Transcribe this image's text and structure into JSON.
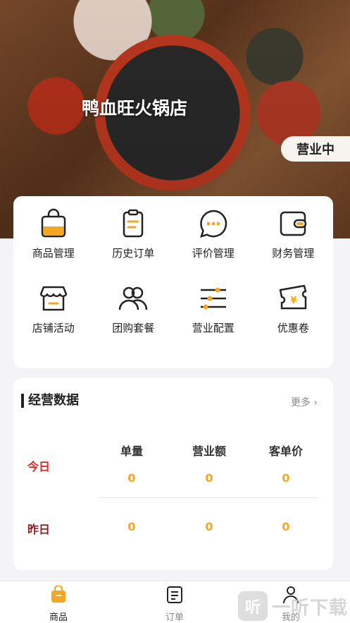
{
  "shop": {
    "name": "鸭血旺火锅店",
    "status": "营业中"
  },
  "menu": {
    "items": [
      {
        "label": "商品管理",
        "icon": "shopping-bag-icon"
      },
      {
        "label": "历史订单",
        "icon": "clipboard-icon"
      },
      {
        "label": "评价管理",
        "icon": "chat-bubble-icon"
      },
      {
        "label": "财务管理",
        "icon": "wallet-icon"
      },
      {
        "label": "店铺活动",
        "icon": "storefront-icon"
      },
      {
        "label": "团购套餐",
        "icon": "group-users-icon"
      },
      {
        "label": "营业配置",
        "icon": "sliders-icon"
      },
      {
        "label": "优惠卷",
        "icon": "coupon-ticket-icon"
      }
    ]
  },
  "stats": {
    "title": "经营数据",
    "more": "更多",
    "columns": [
      "单量",
      "营业额",
      "客单价"
    ],
    "rows": [
      {
        "label": "今日",
        "values": [
          "0",
          "0",
          "0"
        ]
      },
      {
        "label": "昨日",
        "values": [
          "0",
          "0",
          "0"
        ]
      }
    ]
  },
  "nav": {
    "items": [
      {
        "label": "商品",
        "icon": "bag-icon",
        "active": true
      },
      {
        "label": "订单",
        "icon": "order-list-icon",
        "active": false
      },
      {
        "label": "我的",
        "icon": "person-icon",
        "active": false
      }
    ]
  },
  "watermark": {
    "glyph": "听",
    "text": "一听下载"
  },
  "colors": {
    "accent": "#f5a623",
    "today": "#e6231f",
    "yesterday": "#8a1f1f"
  }
}
